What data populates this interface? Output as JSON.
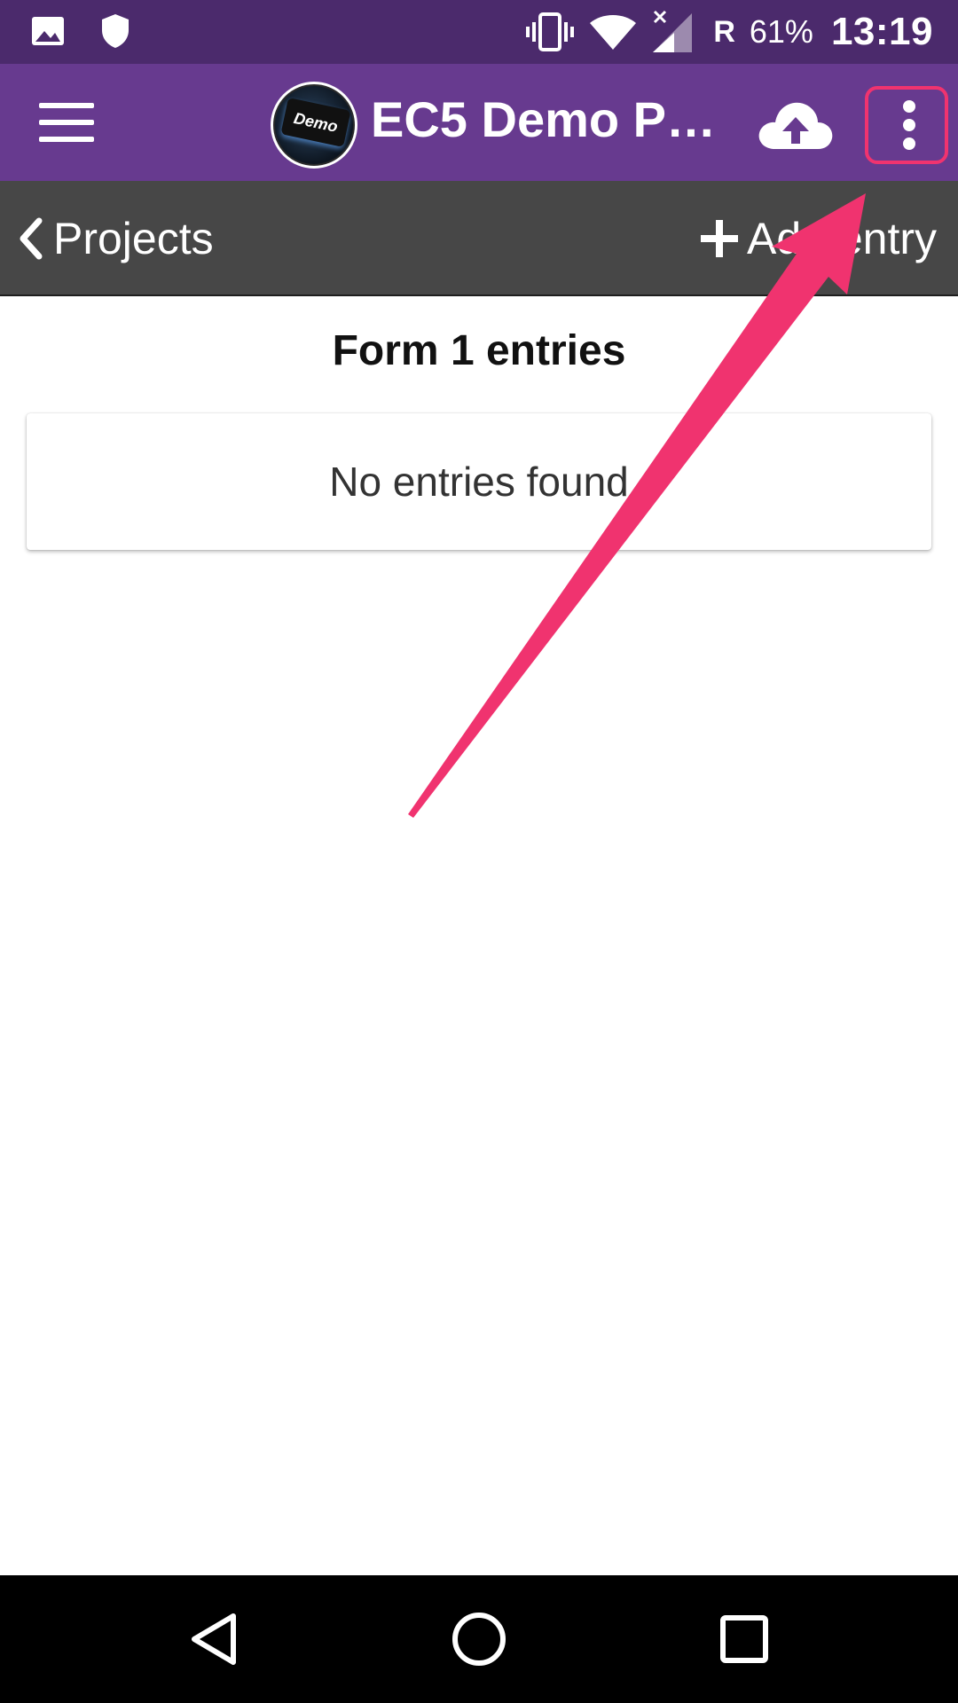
{
  "status_bar": {
    "icons": [
      "image-icon",
      "shield-icon",
      "vibrate-icon",
      "wifi-icon",
      "signal-icon"
    ],
    "roaming": "R",
    "battery": "61%",
    "time": "13:19"
  },
  "app_bar": {
    "logo_text": "Demo",
    "title": "EC5 Demo P…",
    "icons": [
      "menu-icon",
      "cloud-upload-icon",
      "more-vertical-icon"
    ],
    "highlight_color": "#f0336f"
  },
  "sub_bar": {
    "back_label": "Projects",
    "add_label": "Add entry"
  },
  "main": {
    "title": "Form 1 entries",
    "empty_message": "No entries found"
  },
  "nav_bar": {
    "icons": [
      "back-triangle-icon",
      "home-circle-icon",
      "recents-square-icon"
    ]
  },
  "colors": {
    "status_bar": "#4b2a6c",
    "app_bar": "#673a8f",
    "sub_bar": "#474747",
    "annotation": "#f0336f"
  }
}
